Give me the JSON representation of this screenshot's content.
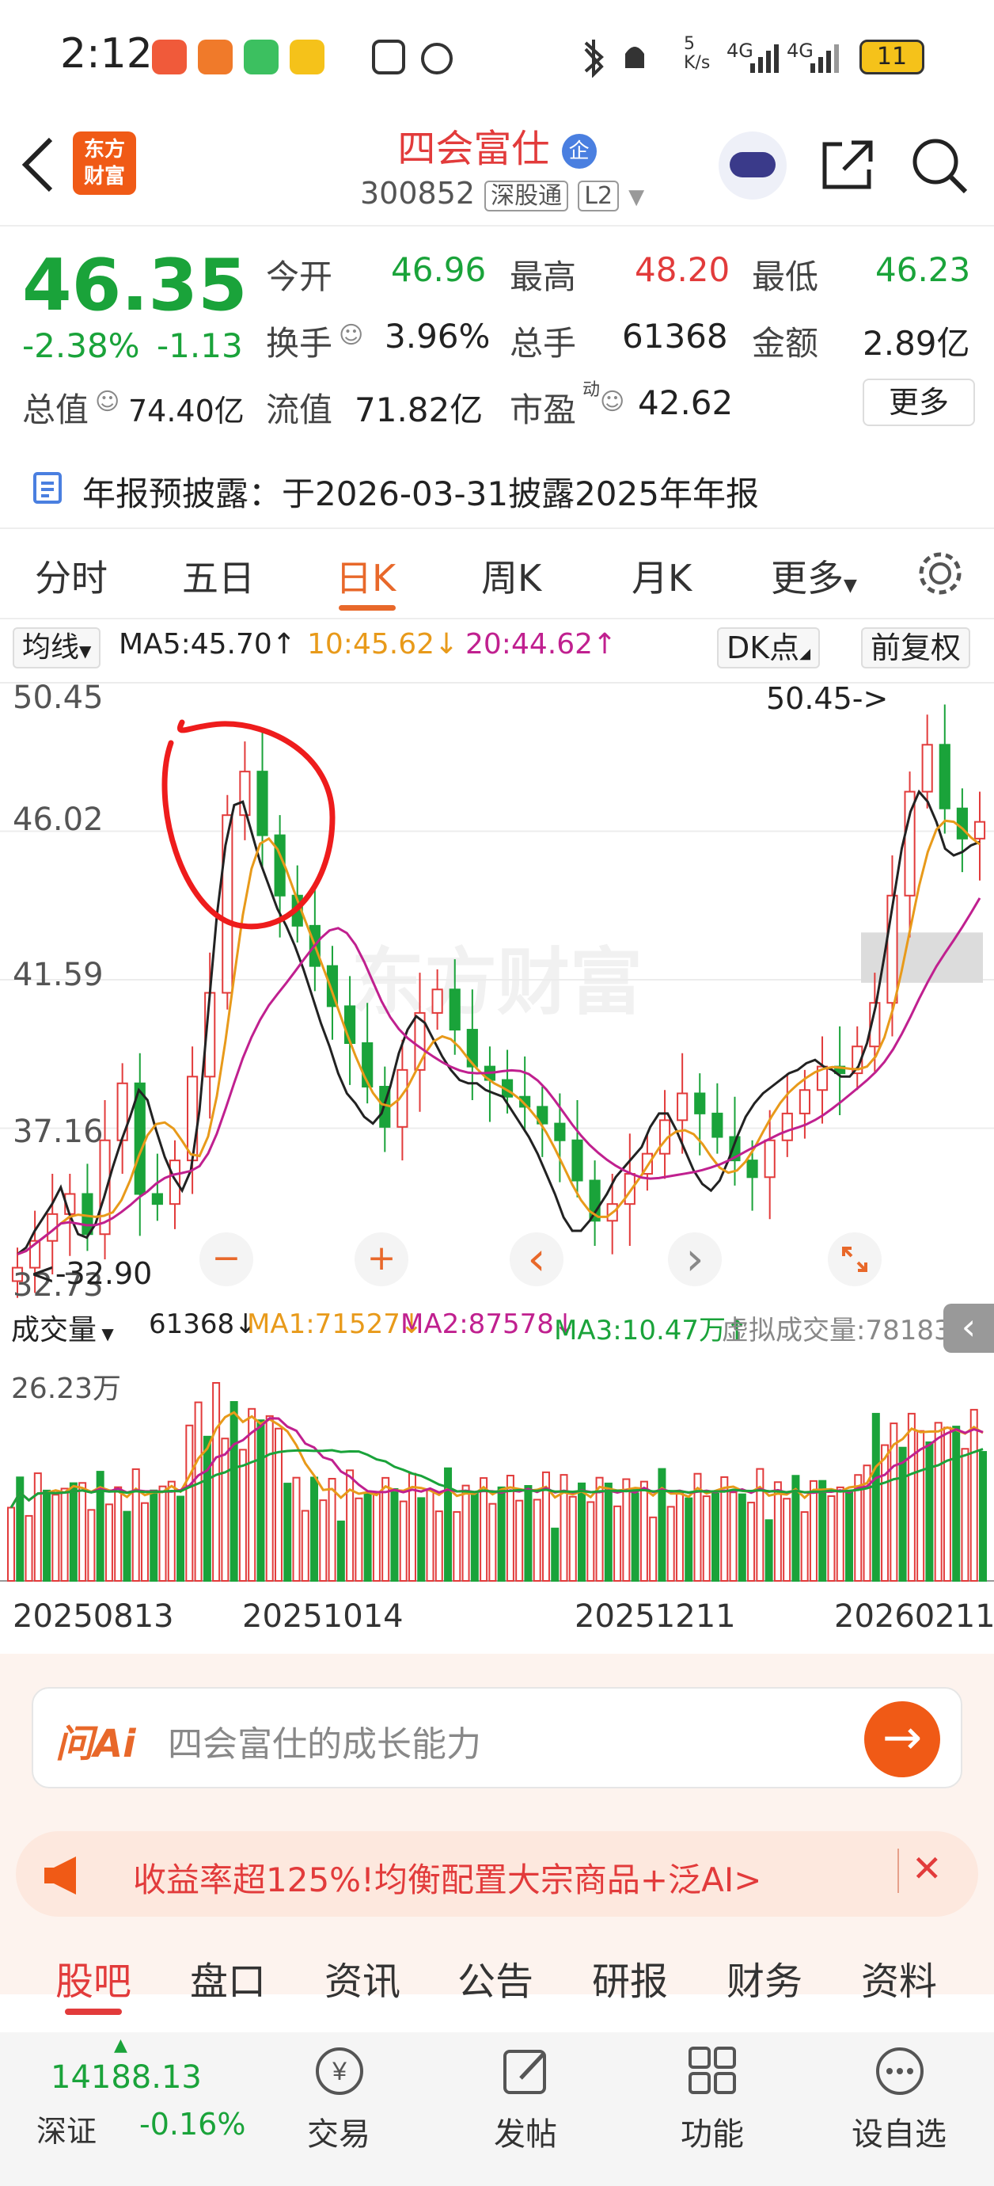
{
  "status_bar": {
    "time": "2:12",
    "net_speed": "5\nK/s",
    "network1": "4G",
    "network2": "4G",
    "battery": "11"
  },
  "header": {
    "back_icon": "chevron-left-icon",
    "logo_text": "东方\n财富",
    "stock_name": "四会富仕",
    "badge": "企",
    "code": "300852",
    "tag1": "深股通",
    "tag2": "L2"
  },
  "quote": {
    "price": "46.35",
    "change_pct": "-2.38%",
    "change_amt": "-1.13",
    "open_label": "今开",
    "open": "46.96",
    "high_label": "最高",
    "high": "48.20",
    "low_label": "最低",
    "low": "46.23",
    "turnover_label": "换手",
    "turnover": "3.96%",
    "volume_label": "总手",
    "volume": "61368",
    "amount_label": "金额",
    "amount": "2.89亿",
    "mktcap_label": "总值",
    "mktcap": "74.40亿",
    "float_label": "流值",
    "float": "71.82亿",
    "pe_label": "市盈",
    "pe_sup": "动",
    "pe": "42.62",
    "more": "更多"
  },
  "notice": {
    "text": "年报预披露：于2026-03-31披露2025年年报"
  },
  "tabs": [
    "分时",
    "五日",
    "日K",
    "周K",
    "月K",
    "更多"
  ],
  "ma": {
    "select": "均线",
    "ma5": "MA5:45.70↑",
    "ma10": "10:45.62↓",
    "ma20": "20:44.62↑",
    "dk": "DK点",
    "adj": "前复权"
  },
  "chart_data": {
    "type": "candlestick",
    "ylabels": [
      "50.45",
      "46.02",
      "41.59",
      "37.16",
      "32.73"
    ],
    "max_note": "50.45->",
    "min_note": "<-32.90",
    "watermark": "东方财富",
    "colors": {
      "up": "#e23b3b",
      "down": "#1aa33a",
      "ma5": "#222222",
      "ma10": "#e89a1a",
      "ma20": "#c0208f"
    },
    "ma5_values": [
      33.4,
      33.6,
      34.1,
      34.5,
      34.9,
      35.4,
      34.6,
      34.0,
      33.9,
      34.3,
      35.1,
      36.0,
      36.8,
      37.5,
      38.3,
      38.0,
      37.1,
      36.3,
      35.7,
      35.3,
      35.9,
      37.7,
      40.6,
      43.5,
      45.6,
      46.8,
      46.9,
      46.0,
      45.1,
      44.4,
      43.7,
      43.2,
      42.6,
      41.9,
      41.1,
      40.3,
      39.6,
      38.8,
      38.2,
      37.9,
      37.5,
      37.3,
      37.6,
      38.4,
      39.4,
      40.1,
      40.5,
      40.3,
      39.8,
      39.3,
      38.9,
      38.6,
      38.5,
      38.5,
      38.3,
      38.2,
      38.1,
      37.7,
      37.3,
      36.9,
      36.4,
      35.8,
      35.2,
      34.5,
      34.1,
      34.1,
      34.4,
      34.8,
      35.2,
      35.7,
      36.0,
      36.3,
      36.6,
      37.2,
      37.6,
      37.6,
      37.1,
      36.5,
      35.9,
      35.5,
      35.3,
      35.6,
      36.2,
      36.9,
      37.5,
      37.9,
      38.2,
      38.4,
      38.6,
      38.8,
      38.9,
      39.1,
      39.2,
      39.0,
      38.9,
      38.7,
      38.7,
      39.0,
      39.7,
      40.8,
      42.3,
      43.9,
      45.5,
      46.6,
      47.2,
      46.9,
      46.3,
      45.5,
      45.3,
      45.4,
      45.6,
      45.7
    ],
    "candles_sample_close": [
      33.0,
      33.8,
      34.6,
      35.2,
      34.0,
      36.8,
      38.5,
      35.2,
      34.9,
      36.2,
      38.7,
      41.2,
      46.5,
      47.8,
      45.9,
      44.1,
      43.2,
      42.0,
      40.8,
      39.7,
      38.4,
      37.2,
      38.9,
      40.6,
      41.3,
      40.1,
      39.0,
      38.6,
      38.1,
      37.8,
      37.3,
      36.8,
      35.6,
      34.4,
      34.9,
      35.8,
      36.4,
      37.4,
      38.2,
      37.6,
      36.9,
      36.2,
      35.7,
      36.8,
      37.6,
      38.3,
      39.0,
      38.8,
      39.6,
      40.9,
      44.1,
      47.2,
      48.6,
      46.7,
      45.8,
      46.3
    ]
  },
  "controls": {
    "minus": "−",
    "plus": "+",
    "left": "‹",
    "right": "›",
    "expand": "expand-icon"
  },
  "volume": {
    "select": "成交量",
    "vol": "61368↓",
    "ma1": "MA1:71527↓",
    "ma2": "MA2:87578↓",
    "ma3": "MA3:10.47万↑",
    "virtual": "虚拟成交量:78183",
    "ylabel": "26.23万"
  },
  "dates": [
    "20250813",
    "20251014",
    "20251211",
    "20260211"
  ],
  "ask_ai": {
    "logo": "问Ai",
    "placeholder": "四会富仕的成长能力",
    "go": "→"
  },
  "ad": {
    "text": "收益率超125%!均衡配置大宗商品+泛AI>",
    "close": "✕"
  },
  "bottom_tabs": [
    "股吧",
    "盘口",
    "资讯",
    "公告",
    "研报",
    "财务",
    "资料"
  ],
  "bottom_nav": {
    "index_value": "14188.13",
    "index_name": "深证",
    "index_change": "-0.16%",
    "trade": "交易",
    "post": "发帖",
    "func": "功能",
    "watch": "设自选"
  }
}
